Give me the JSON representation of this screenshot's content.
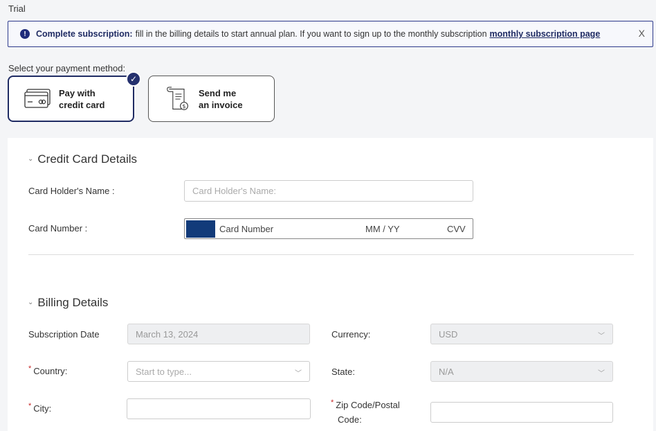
{
  "page": {
    "trial_label": "Trial"
  },
  "alert": {
    "strong": "Complete subscription:",
    "message": "fill in the billing details to start annual plan. If you want to sign up to the monthly subscription",
    "link": "monthly subscription page",
    "close": "X"
  },
  "payment": {
    "label": "Select your payment method:",
    "options": [
      {
        "line1": "Pay with",
        "line2": "credit card",
        "selected": true
      },
      {
        "line1": "Send me",
        "line2": "an invoice",
        "selected": false
      }
    ]
  },
  "credit_card": {
    "title": "Credit Card Details",
    "holder_label": "Card Holder's Name :",
    "holder_placeholder": "Card Holder's Name:",
    "number_label": "Card Number :",
    "number_placeholder": "Card Number",
    "expiry_placeholder": "MM / YY",
    "cvv_placeholder": "CVV",
    "brand_color": "#123b7a"
  },
  "billing": {
    "title": "Billing Details",
    "subscription_date_label": "Subscription Date",
    "subscription_date_value": "March 13, 2024",
    "currency_label": "Currency:",
    "currency_value": "USD",
    "country_label": "Country:",
    "country_placeholder": "Start to type...",
    "state_label": "State:",
    "state_value": "N/A",
    "city_label": "City:",
    "city_value": "",
    "zip_label_1": "Zip Code/Postal",
    "zip_label_2": "Code:",
    "zip_value": ""
  },
  "colors": {
    "accent": "#1f2b63",
    "required": "#c62828"
  }
}
